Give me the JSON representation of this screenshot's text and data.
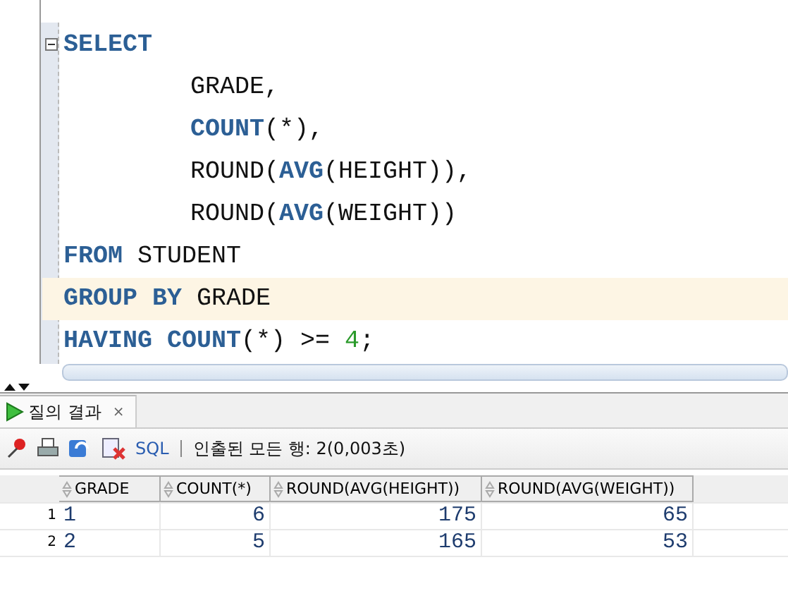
{
  "editor": {
    "lines": [
      {
        "indented": false,
        "highlighted": false,
        "foldable": true,
        "tokens": [
          {
            "text": "SELECT",
            "kind": "keyword"
          }
        ]
      },
      {
        "indented": true,
        "highlighted": false,
        "foldable": false,
        "tokens": [
          {
            "text": "GRADE,",
            "kind": "plain"
          }
        ]
      },
      {
        "indented": true,
        "highlighted": false,
        "foldable": false,
        "tokens": [
          {
            "text": "COUNT",
            "kind": "keyword"
          },
          {
            "text": "(*),",
            "kind": "plain"
          }
        ]
      },
      {
        "indented": true,
        "highlighted": false,
        "foldable": false,
        "tokens": [
          {
            "text": "ROUND(",
            "kind": "plain"
          },
          {
            "text": "AVG",
            "kind": "keyword"
          },
          {
            "text": "(HEIGHT)),",
            "kind": "plain"
          }
        ]
      },
      {
        "indented": true,
        "highlighted": false,
        "foldable": false,
        "tokens": [
          {
            "text": "ROUND(",
            "kind": "plain"
          },
          {
            "text": "AVG",
            "kind": "keyword"
          },
          {
            "text": "(WEIGHT))",
            "kind": "plain"
          }
        ]
      },
      {
        "indented": false,
        "highlighted": false,
        "foldable": false,
        "tokens": [
          {
            "text": "FROM",
            "kind": "keyword"
          },
          {
            "text": " STUDENT",
            "kind": "plain"
          }
        ]
      },
      {
        "indented": false,
        "highlighted": true,
        "foldable": false,
        "tokens": [
          {
            "text": "GROUP BY",
            "kind": "keyword"
          },
          {
            "text": " GRADE",
            "kind": "plain"
          }
        ]
      },
      {
        "indented": false,
        "highlighted": false,
        "foldable": false,
        "tokens": [
          {
            "text": "HAVING COUNT",
            "kind": "keyword"
          },
          {
            "text": "(*) >= ",
            "kind": "plain"
          },
          {
            "text": "4",
            "kind": "number"
          },
          {
            "text": ";",
            "kind": "plain"
          }
        ]
      }
    ]
  },
  "results": {
    "tab": {
      "label": "질의 결과",
      "close": "×",
      "selected": true
    },
    "toolbar": {
      "sql": "SQL",
      "status": "인출된 모든 행: 2(0,003초)"
    },
    "table": {
      "columns": [
        "GRADE",
        "COUNT(*)",
        "ROUND(AVG(HEIGHT))",
        "ROUND(AVG(WEIGHT))"
      ],
      "rows": [
        {
          "number": "1",
          "cells": [
            "1",
            "6",
            "175",
            "65"
          ]
        },
        {
          "number": "2",
          "cells": [
            "2",
            "5",
            "165",
            "53"
          ]
        }
      ]
    }
  }
}
